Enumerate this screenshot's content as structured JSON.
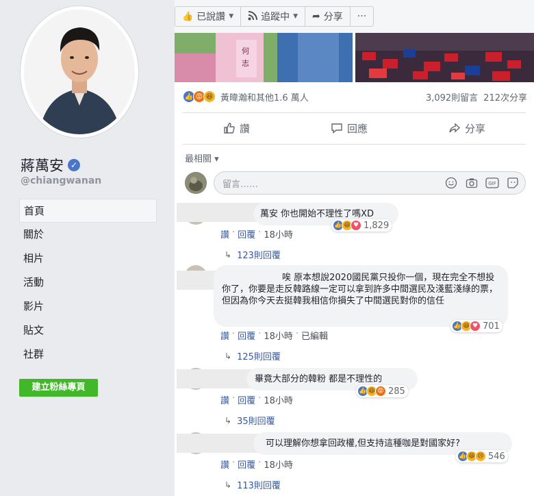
{
  "sidebar": {
    "page_name": "蔣萬安",
    "handle": "@chiangwanan",
    "nav": [
      "首頁",
      "關於",
      "相片",
      "活動",
      "影片",
      "貼文",
      "社群"
    ],
    "create_button": "建立粉絲專頁"
  },
  "actions": {
    "liked": "已說讚",
    "following": "追蹤中",
    "share": "分享",
    "more": "···"
  },
  "post": {
    "reaction_names": "黃暐瀚和其他1.6 萬人",
    "comment_count": "3,092則留言",
    "share_count": "212次分享",
    "like_label": "讚",
    "comment_label": "回應",
    "share_label": "分享",
    "sort_label": "最相關 ▾",
    "comment_placeholder": "留言……"
  },
  "comments": [
    {
      "text": "萬安 你也開始不理性了嗎XD",
      "count": "1,829",
      "like": "讚",
      "reply": "回覆",
      "time": "18小時",
      "edited": "",
      "replies": "123則回覆"
    },
    {
      "text": "唉 原本想說2020國民黨只投你一個，現在完全不想投你了，你要是走反韓路線一定可以拿到許多中間選民及淺藍淺綠的票，但因為你今天去挺韓我相信你損失了中間選民對你的信任",
      "count": "701",
      "like": "讚",
      "reply": "回覆",
      "time": "18小時",
      "edited": "已編輯",
      "replies": "125則回覆"
    },
    {
      "text": "畢竟大部分的韓粉 都是不理性的",
      "count": "285",
      "like": "讚",
      "reply": "回覆",
      "time": "18小時",
      "edited": "",
      "replies": "35則回覆"
    },
    {
      "text": "可以理解你想拿回政權,但支持這種咖是對國家好?",
      "count": "546",
      "like": "讚",
      "reply": "回覆",
      "time": "18小時",
      "edited": "",
      "replies": "113則回覆"
    }
  ],
  "icons": {
    "like_icon": "thumbs-up",
    "rss_icon": "rss",
    "share_icon": "share-arrow",
    "verified_icon": "check-badge"
  },
  "colors": {
    "accent_blue": "#4a76c8",
    "green_button": "#42b72a",
    "link": "#385898"
  }
}
